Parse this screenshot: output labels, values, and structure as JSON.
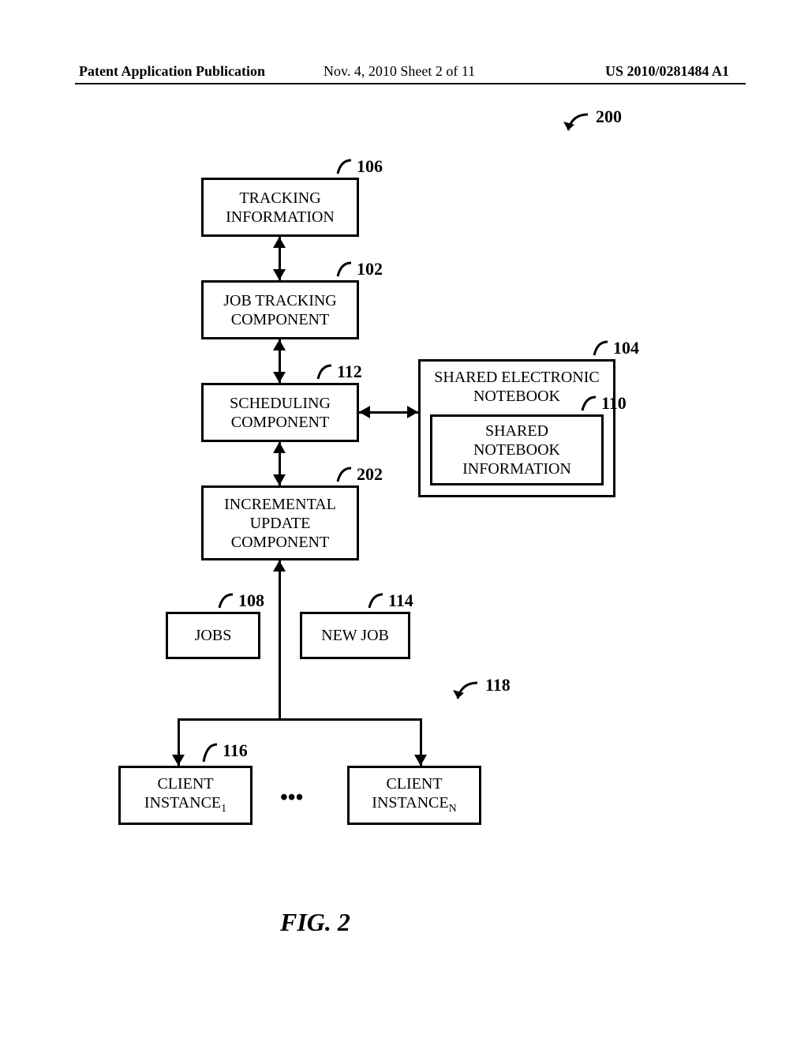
{
  "header": {
    "left": "Patent Application Publication",
    "mid": "Nov. 4, 2010   Sheet 2 of 11",
    "right": "US 2010/0281484 A1"
  },
  "refs": {
    "r200": "200",
    "r106": "106",
    "r102": "102",
    "r112": "112",
    "r104": "104",
    "r110": "110",
    "r202": "202",
    "r108": "108",
    "r114": "114",
    "r118": "118",
    "r116": "116"
  },
  "boxes": {
    "tracking_info": "TRACKING\nINFORMATION",
    "job_tracking": "JOB TRACKING\nCOMPONENT",
    "scheduling": "SCHEDULING\nCOMPONENT",
    "shared_notebook_outer": "SHARED ELECTRONIC\nNOTEBOOK",
    "shared_notebook_inner": "SHARED\nNOTEBOOK\nINFORMATION",
    "incremental": "INCREMENTAL\nUPDATE\nCOMPONENT",
    "jobs": "JOBS",
    "new_job": "NEW JOB",
    "client1_prefix": "CLIENT\nINSTANCE",
    "client1_sub": "1",
    "clientN_prefix": "CLIENT\nINSTANCE",
    "clientN_sub": "N"
  },
  "figure_caption": "FIG. 2",
  "ellipsis": "•••"
}
